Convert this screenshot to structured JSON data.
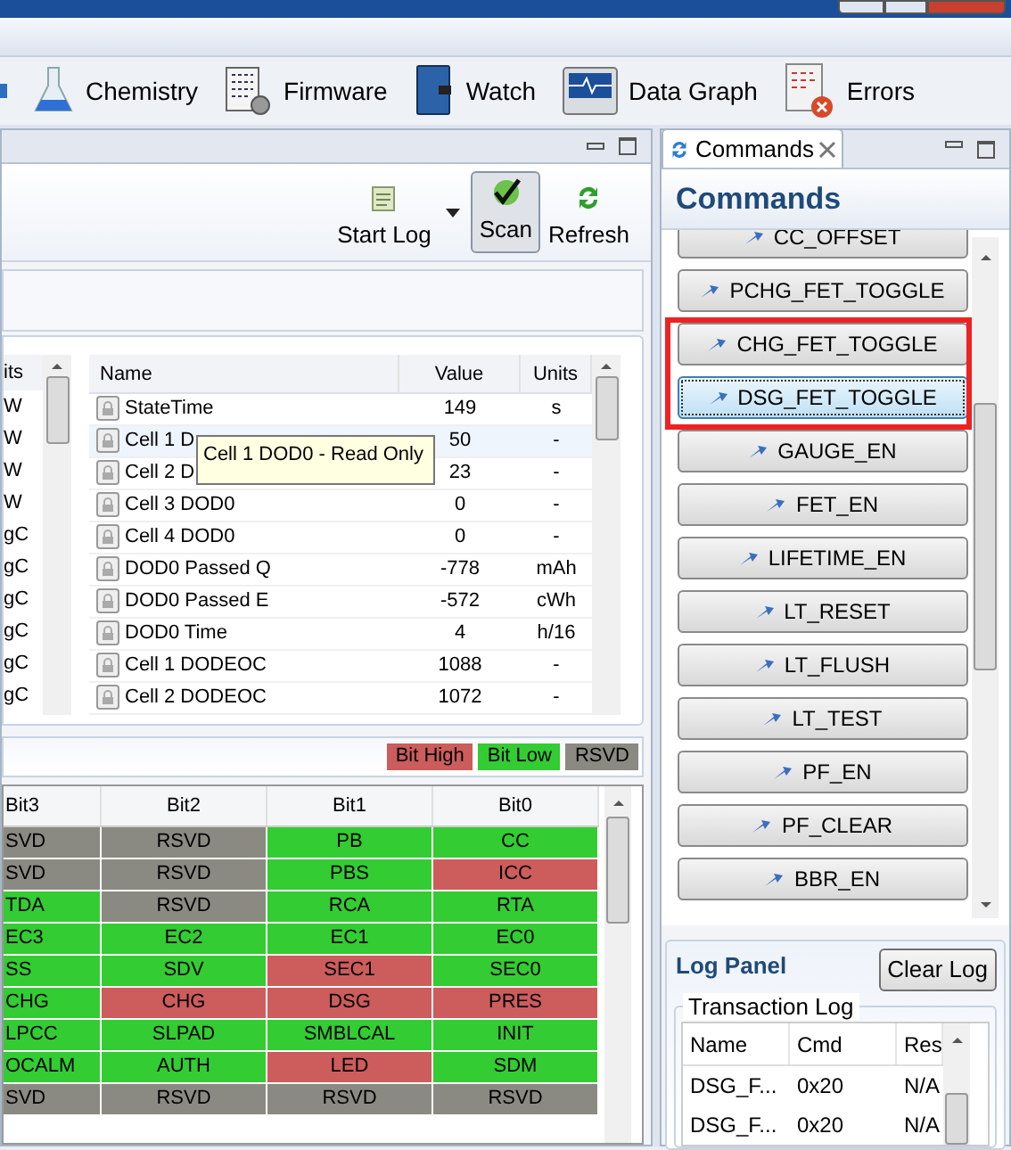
{
  "toolbar": [
    {
      "label": "Chemistry"
    },
    {
      "label": "Firmware"
    },
    {
      "label": "Watch"
    },
    {
      "label": "Data Graph"
    },
    {
      "label": "Errors"
    }
  ],
  "main_toolbar": {
    "start_log": "Start Log",
    "scan": {
      "label": "Scan",
      "pressed": true
    },
    "refresh": "Refresh"
  },
  "left_table": {
    "column": "its",
    "rows": [
      "W",
      "W",
      "W",
      "W",
      "gC",
      "gC",
      "gC",
      "gC",
      "gC",
      "gC"
    ]
  },
  "data_table": {
    "columns": [
      "Name",
      "Value",
      "Units"
    ],
    "rows": [
      {
        "name": "StateTime",
        "value": "149",
        "units": "s"
      },
      {
        "name": "Cell 1 D",
        "value": "50",
        "units": "-"
      },
      {
        "name": "Cell 2 D",
        "value": "23",
        "units": "-"
      },
      {
        "name": "Cell 3 DOD0",
        "value": "0",
        "units": "-"
      },
      {
        "name": "Cell 4 DOD0",
        "value": "0",
        "units": "-"
      },
      {
        "name": "DOD0 Passed Q",
        "value": "-778",
        "units": "mAh"
      },
      {
        "name": "DOD0 Passed E",
        "value": "-572",
        "units": "cWh"
      },
      {
        "name": "DOD0 Time",
        "value": "4",
        "units": "h/16"
      },
      {
        "name": "Cell 1 DODEOC",
        "value": "1088",
        "units": "-"
      },
      {
        "name": "Cell 2 DODEOC",
        "value": "1072",
        "units": "-"
      }
    ]
  },
  "tooltip": "Cell 1 DOD0 - Read Only",
  "legend": [
    {
      "label": "Bit High",
      "color": "#cd5c5c"
    },
    {
      "label": "Bit Low",
      "color": "#33cc33"
    },
    {
      "label": "RSVD",
      "color": "#8b8a82"
    }
  ],
  "bit_table": {
    "columns": [
      "Bit3",
      "Bit2",
      "Bit1",
      "Bit0"
    ],
    "rows": [
      [
        {
          "text": "SVD",
          "color": "#8b8a82"
        },
        {
          "text": "RSVD",
          "color": "#8b8a82"
        },
        {
          "text": "PB",
          "color": "#33cc33"
        },
        {
          "text": "CC",
          "color": "#33cc33"
        }
      ],
      [
        {
          "text": "SVD",
          "color": "#8b8a82"
        },
        {
          "text": "RSVD",
          "color": "#8b8a82"
        },
        {
          "text": "PBS",
          "color": "#33cc33"
        },
        {
          "text": "ICC",
          "color": "#cd5c5c"
        }
      ],
      [
        {
          "text": "TDA",
          "color": "#33cc33"
        },
        {
          "text": "RSVD",
          "color": "#8b8a82"
        },
        {
          "text": "RCA",
          "color": "#33cc33"
        },
        {
          "text": "RTA",
          "color": "#33cc33"
        }
      ],
      [
        {
          "text": "EC3",
          "color": "#33cc33"
        },
        {
          "text": "EC2",
          "color": "#33cc33"
        },
        {
          "text": "EC1",
          "color": "#33cc33"
        },
        {
          "text": "EC0",
          "color": "#33cc33"
        }
      ],
      [
        {
          "text": "SS",
          "color": "#33cc33"
        },
        {
          "text": "SDV",
          "color": "#33cc33"
        },
        {
          "text": "SEC1",
          "color": "#cd5c5c"
        },
        {
          "text": "SEC0",
          "color": "#33cc33"
        }
      ],
      [
        {
          "text": "CHG",
          "color": "#33cc33"
        },
        {
          "text": "CHG",
          "color": "#cd5c5c"
        },
        {
          "text": "DSG",
          "color": "#cd5c5c"
        },
        {
          "text": "PRES",
          "color": "#cd5c5c"
        }
      ],
      [
        {
          "text": "LPCC",
          "color": "#33cc33"
        },
        {
          "text": "SLPAD",
          "color": "#33cc33"
        },
        {
          "text": "SMBLCAL",
          "color": "#33cc33"
        },
        {
          "text": "INIT",
          "color": "#33cc33"
        }
      ],
      [
        {
          "text": "OCALM",
          "color": "#33cc33"
        },
        {
          "text": "AUTH",
          "color": "#33cc33"
        },
        {
          "text": "LED",
          "color": "#cd5c5c"
        },
        {
          "text": "SDM",
          "color": "#33cc33"
        }
      ],
      [
        {
          "text": "SVD",
          "color": "#8b8a82"
        },
        {
          "text": "RSVD",
          "color": "#8b8a82"
        },
        {
          "text": "RSVD",
          "color": "#8b8a82"
        },
        {
          "text": "RSVD",
          "color": "#8b8a82"
        }
      ]
    ]
  },
  "commands_panel": {
    "tab": "Commands",
    "title": "Commands",
    "buttons": [
      {
        "label": "CC_OFFSET",
        "focused": false,
        "highlighted": false
      },
      {
        "label": "PCHG_FET_TOGGLE",
        "focused": false,
        "highlighted": false
      },
      {
        "label": "CHG_FET_TOGGLE",
        "focused": false,
        "highlighted": true
      },
      {
        "label": "DSG_FET_TOGGLE",
        "focused": true,
        "highlighted": true
      },
      {
        "label": "GAUGE_EN",
        "focused": false,
        "highlighted": false
      },
      {
        "label": "FET_EN",
        "focused": false,
        "highlighted": false
      },
      {
        "label": "LIFETIME_EN",
        "focused": false,
        "highlighted": false
      },
      {
        "label": "LT_RESET",
        "focused": false,
        "highlighted": false
      },
      {
        "label": "LT_FLUSH",
        "focused": false,
        "highlighted": false
      },
      {
        "label": "LT_TEST",
        "focused": false,
        "highlighted": false
      },
      {
        "label": "PF_EN",
        "focused": false,
        "highlighted": false
      },
      {
        "label": "PF_CLEAR",
        "focused": false,
        "highlighted": false
      },
      {
        "label": "BBR_EN",
        "focused": false,
        "highlighted": false
      }
    ]
  },
  "log_panel": {
    "title": "Log Panel",
    "clear_button": "Clear Log",
    "group": "Transaction Log",
    "columns": [
      "Name",
      "Cmd",
      "Res"
    ],
    "rows": [
      [
        "DSG_F...",
        "0x20",
        "N/A"
      ],
      [
        "DSG_F...",
        "0x20",
        "N/A"
      ]
    ]
  }
}
